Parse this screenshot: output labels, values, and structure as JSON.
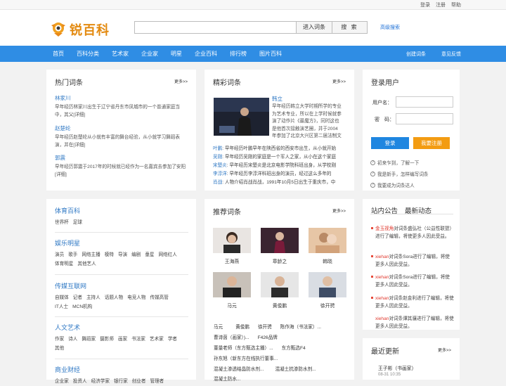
{
  "toplinks": [
    "登录",
    "注册",
    "帮助"
  ],
  "logo": {
    "text": "锐百科"
  },
  "search": {
    "value": "",
    "entry_label": "进入词条",
    "search_label": "搜 索",
    "advanced": "高级搜索"
  },
  "nav": {
    "items": [
      "首页",
      "百科分类",
      "艺术家",
      "企业家",
      "明星",
      "企业百科",
      "排行榜",
      "图片百科"
    ],
    "right": [
      "创建词条",
      "意见反馈"
    ]
  },
  "hot": {
    "title": "热门词条",
    "more": "更多>>",
    "items": [
      {
        "name": "林家川",
        "desc": "早年经历林家川出生于辽宁省丹东市凤城市的一个普通家庭当中，其父[详细]"
      },
      {
        "name": "赵楚纶",
        "desc": "早年经历赵楚纶从小就有丰富的舞台经验，从小就学习舞蹈表演，并在[详细]"
      },
      {
        "name": "郭震",
        "desc": "早年经历郭震于2017年的时候就已经作为一名嘉宾去参加了安阳[详细]"
      }
    ]
  },
  "featured": {
    "title": "精彩词条",
    "more": "更多>>",
    "main_name": "韩立",
    "main_desc": [
      "早年经历韩立大学时期所学的专业",
      "为艺术专业，所以在上学时候就参",
      "演了动作片《最魔方》，同时这也",
      "是他首次接触演艺圈，并于2004",
      "年参加了北京大兴区第二届法制文"
    ],
    "lines": [
      {
        "name": "叶鹏",
        "text": ": 早年经历叶鹏早年在陕西省的西安市出生，从小就开始"
      },
      {
        "name": "吴刚",
        "text": ": 早年经历吴刚的家庭是一个军人之家，从小在这个家庭"
      },
      {
        "name": "宋楚炎",
        "text": ": 早年经历宋楚炎是北京电影学院科班出身，从学校刚"
      },
      {
        "name": "李淳洋",
        "text": ": 早年经历李淳洋科班出身的演员，经过这么多年的"
      },
      {
        "name": "肖战",
        "text": ": 人物介绍肖战肖战，1991年10月5日出生于重庆市，中"
      }
    ]
  },
  "login": {
    "title": "登录用户",
    "user_label": "用户名：",
    "pass_label": "密　码：",
    "login_btn": "登录",
    "reg_btn": "我要注册",
    "tips": [
      "初来乍到，了解一下",
      "我是新手，怎样编写词条",
      "我要成为词条达人"
    ]
  },
  "categories": [
    {
      "title": "体育百科",
      "items": [
        "世界杯",
        "足球"
      ]
    },
    {
      "title": "娱乐明星",
      "items": [
        "演员",
        "歌手",
        "网络主播",
        "模特",
        "导演",
        "编剧",
        "童星",
        "网络红人",
        "体育明星",
        "其他艺人"
      ]
    },
    {
      "title": "传媒互联网",
      "items": [
        "自媒体",
        "记者",
        "主持人",
        "话题人物",
        "电竞人物",
        "传媒高管",
        "IT人士",
        "MCN机构"
      ]
    },
    {
      "title": "人文艺术",
      "items": [
        "作家",
        "诗人",
        "舞蹈家",
        "摄影师",
        "画家",
        "书法家",
        "艺术家",
        "学者",
        "其他"
      ]
    },
    {
      "title": "商业财经",
      "items": [
        "企业家",
        "投资人",
        "经济学家",
        "银行家",
        "创业者",
        "管理者"
      ]
    }
  ],
  "recommend": {
    "title": "推荐词条",
    "more": "更多>>",
    "people": [
      "王海燕",
      "章龄之",
      "韩晓",
      "马元",
      "黄俊鹏",
      "徐开骋"
    ],
    "rows": [
      [
        "马元",
        "黄俊鹏",
        "徐开骋",
        "陈作海（书法家）..."
      ],
      [
        "曹诗茵（画家）)...",
        "F426品牌"
      ],
      [
        "董量老师（东方甄选主播）...",
        "东方甄选F4"
      ],
      [
        "孙东旭（新东方在线执行董事...",
        ""
      ],
      [
        "混凝土渗透结晶防水剂...",
        "混凝土抗渗防水剂..."
      ],
      [
        "混凝土防水..."
      ]
    ]
  },
  "notice": {
    "tabs": [
      "站内公告",
      "最新动态"
    ],
    "items": [
      {
        "user": "金玉视角",
        "text": "对词条盛弘社（公益性联盟）进行了编辑，将使更多人因此受益。"
      },
      {
        "user": "xiehan",
        "text": "对词条Sora进行了编辑，将使更多人因此受益。"
      },
      {
        "user": "xiehan",
        "text": "对词条Sora进行了编辑，将使更多人因此受益。"
      },
      {
        "user": "xiehan",
        "text": "对词条赵金利进行了编辑，将使更多人因此受益。"
      },
      {
        "user": "xiehan",
        "text": "对词条谭其骧进行了编辑，将使更多人因此受益。"
      }
    ]
  },
  "recent": {
    "title": "最近更新",
    "more": "更多>>",
    "item": "王子彬（书画家）",
    "time": "08-31 10:35"
  }
}
